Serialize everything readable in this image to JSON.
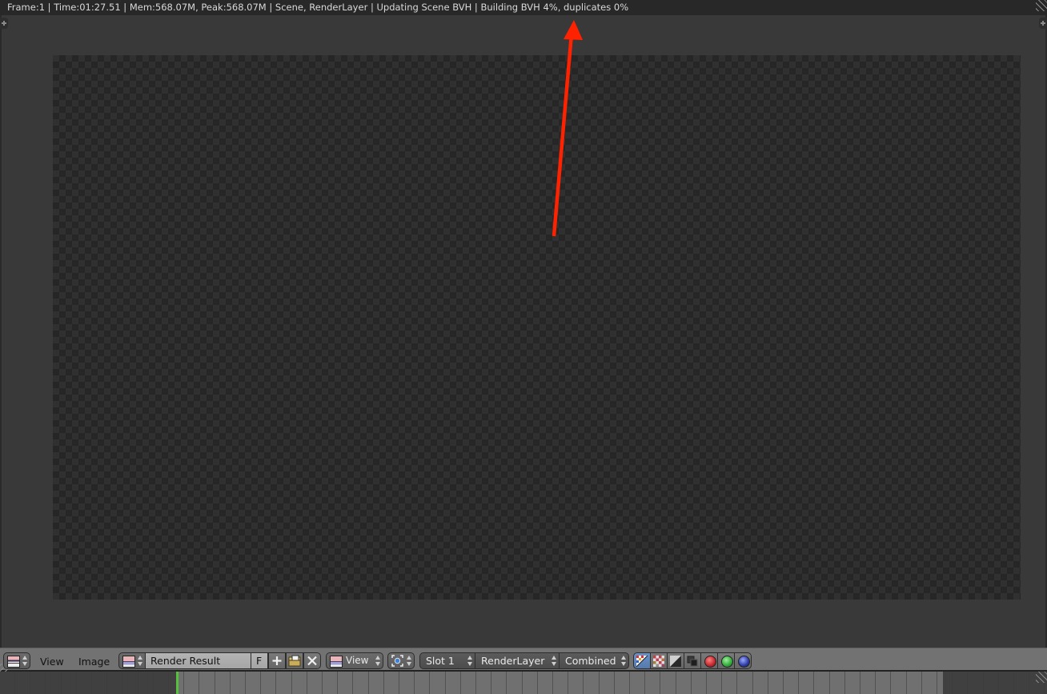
{
  "info_bar": {
    "text": "Frame:1 | Time:01:27.51 | Mem:568.07M, Peak:568.07M | Scene, RenderLayer | Updating Scene BVH | Building BVH 4%, duplicates 0%"
  },
  "header": {
    "editor_type_icon": "image-editor-icon",
    "menus": [
      {
        "label": "View"
      },
      {
        "label": "Image"
      }
    ],
    "image_browse_icon": "image-datablock-icon",
    "image_name": "Render Result",
    "fake_user_label": "F",
    "new_image_icon": "plus-icon",
    "open_image_icon": "folder-open-icon",
    "unlink_icon": "x-icon",
    "mode_select": {
      "icon": "image-view-icon",
      "value": "View"
    },
    "pivot_icon": "pivot-center-icon",
    "slot_select": {
      "value": "Slot 1"
    },
    "layer_select": {
      "value": "RenderLayer"
    },
    "pass_select": {
      "value": "Combined"
    },
    "display_channels": [
      {
        "name": "color-alpha",
        "icon": "color-alpha-icon",
        "active": true
      },
      {
        "name": "color",
        "icon": "checker-color-icon",
        "active": false
      },
      {
        "name": "alpha",
        "icon": "alpha-icon",
        "active": false
      },
      {
        "name": "z-buffer",
        "icon": "zbuffer-icon",
        "active": false
      },
      {
        "name": "red",
        "icon": "red-channel-icon",
        "active": false,
        "color": "#c0272d"
      },
      {
        "name": "green",
        "icon": "green-channel-icon",
        "active": false,
        "color": "#2fa83a"
      },
      {
        "name": "blue",
        "icon": "blue-channel-icon",
        "active": false,
        "color": "#2b3aa0"
      }
    ]
  },
  "annotation": {
    "type": "arrow",
    "color": "#ff2200",
    "points_to": "info-bar-status-text"
  },
  "timeline": {
    "current_frame_color": "#56c13a"
  }
}
